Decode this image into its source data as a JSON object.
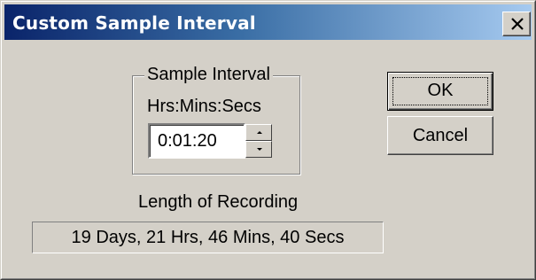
{
  "window": {
    "title": "Custom Sample Interval",
    "close_icon": "close-icon"
  },
  "sample_interval": {
    "group_label": "Sample Interval",
    "format_label": "Hrs:Mins:Secs",
    "value": "0:01:20",
    "spin_up_icon": "arrow-up-icon",
    "spin_down_icon": "arrow-down-icon"
  },
  "recording": {
    "label": "Length of Recording",
    "value": "19 Days, 21 Hrs, 46 Mins, 40 Secs"
  },
  "buttons": {
    "ok_label": "OK",
    "cancel_label": "Cancel"
  },
  "colors": {
    "dialog_face": "#d4d0c8",
    "title_gradient_start": "#0a246a",
    "title_gradient_end": "#a6caf0"
  }
}
